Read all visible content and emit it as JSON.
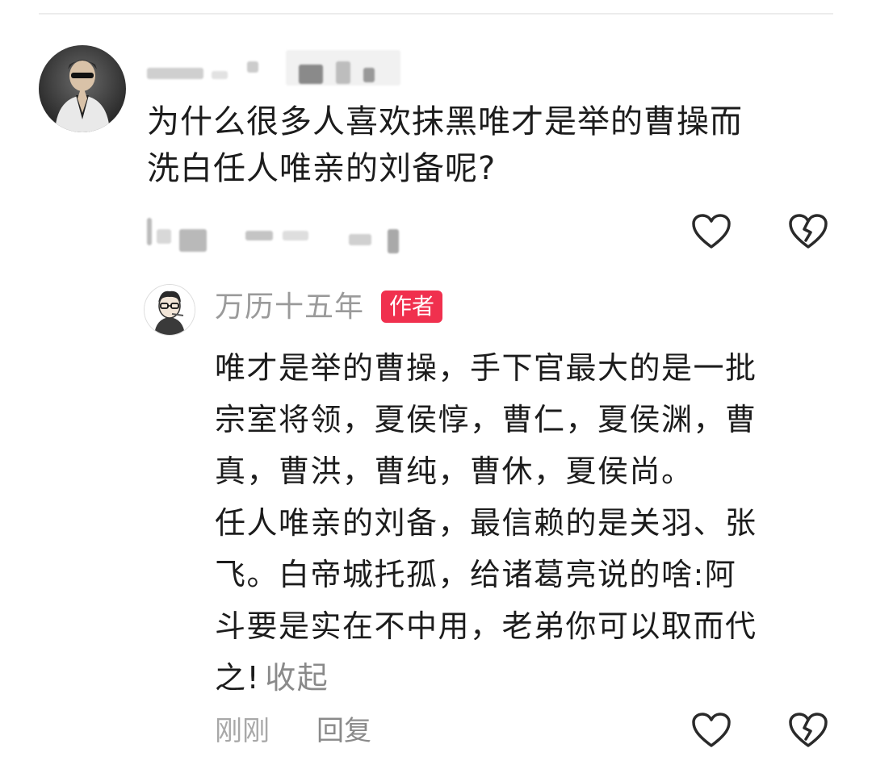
{
  "question": {
    "line1": "为什么很多人喜欢抹黑唯才是举的曹操而",
    "line2": "洗白任人唯亲的刘备呢?"
  },
  "reply": {
    "author_name": "万历十五年",
    "author_badge": "作者",
    "lines": [
      "唯才是举的曹操，手下官最大的是一批",
      "宗室将领，夏侯惇，曹仁，夏侯渊，曹",
      "真，曹洪，曹纯，曹休，夏侯尚。",
      "任人唯亲的刘备，最信赖的是关羽、张",
      "飞。白帝城托孤，给诸葛亮说的啥:阿",
      "斗要是实在不中用，老弟你可以取而代",
      "之!"
    ],
    "collapse_label": "收起",
    "time_label": "刚刚",
    "reply_label": "回复"
  },
  "icons": {
    "like": "heart-icon",
    "dislike": "broken-heart-icon"
  },
  "colors": {
    "badge": "#f0304e",
    "muted_text": "#9a9a9a",
    "body_text": "#1c1c1c"
  }
}
